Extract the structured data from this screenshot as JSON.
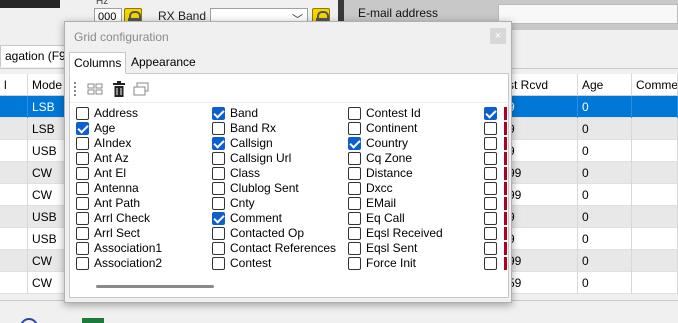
{
  "background": {
    "hz_label": "Hz",
    "freq_value": "000",
    "rx_band_label": "RX Band",
    "rx_band_value": "",
    "email_label": "E-mail address",
    "tab_label": "agation (F9",
    "grid": {
      "headers": [
        "l",
        "Mode",
        "",
        "st Rcvd",
        "Age",
        "Comme"
      ],
      "rows": [
        {
          "mode": "LSB",
          "rcvd": "9",
          "age": "0"
        },
        {
          "mode": "LSB",
          "rcvd": "9",
          "age": "0"
        },
        {
          "mode": "USB",
          "rcvd": "9",
          "age": "0"
        },
        {
          "mode": "CW",
          "rcvd": "99",
          "age": "0"
        },
        {
          "mode": "CW",
          "rcvd": "99",
          "age": "0"
        },
        {
          "mode": "USB",
          "rcvd": "9",
          "age": "0"
        },
        {
          "mode": "USB",
          "rcvd": "9",
          "age": "0"
        },
        {
          "mode": "CW",
          "rcvd": "99",
          "age": "0"
        },
        {
          "mode": "CW",
          "rcvd": "59",
          "age": "0"
        }
      ]
    }
  },
  "dialog": {
    "title": "Grid configuration",
    "close_glyph": "×",
    "tabs": [
      "Columns",
      "Appearance"
    ],
    "toolbar": {
      "grid_icon": "grid-layout-icon",
      "delete_icon": "trash-icon",
      "window_icon": "window-icon"
    },
    "columns": [
      [
        {
          "label": "Address",
          "checked": false
        },
        {
          "label": "Age",
          "checked": true
        },
        {
          "label": "AIndex",
          "checked": false
        },
        {
          "label": "Ant Az",
          "checked": false
        },
        {
          "label": "Ant El",
          "checked": false
        },
        {
          "label": "Antenna",
          "checked": false
        },
        {
          "label": "Ant Path",
          "checked": false
        },
        {
          "label": "Arrl Check",
          "checked": false
        },
        {
          "label": "Arrl Sect",
          "checked": false
        },
        {
          "label": "Association1",
          "checked": false
        },
        {
          "label": "Association2",
          "checked": false
        }
      ],
      [
        {
          "label": "Band",
          "checked": true
        },
        {
          "label": "Band Rx",
          "checked": false
        },
        {
          "label": "Callsign",
          "checked": true
        },
        {
          "label": "Callsign Url",
          "checked": false
        },
        {
          "label": "Class",
          "checked": false
        },
        {
          "label": "Clublog Sent",
          "checked": false
        },
        {
          "label": "Cnty",
          "checked": false
        },
        {
          "label": "Comment",
          "checked": true
        },
        {
          "label": "Contacted Op",
          "checked": false
        },
        {
          "label": "Contact References",
          "checked": false
        },
        {
          "label": "Contest",
          "checked": false
        }
      ],
      [
        {
          "label": "Contest Id",
          "checked": false
        },
        {
          "label": "Continent",
          "checked": false
        },
        {
          "label": "Country",
          "checked": true
        },
        {
          "label": "Cq Zone",
          "checked": false
        },
        {
          "label": "Distance",
          "checked": false
        },
        {
          "label": "Dxcc",
          "checked": false
        },
        {
          "label": "EMail",
          "checked": false
        },
        {
          "label": "Eq Call",
          "checked": false
        },
        {
          "label": "Eqsl Received",
          "checked": false
        },
        {
          "label": "Eqsl Sent",
          "checked": false
        },
        {
          "label": "Force Init",
          "checked": false
        }
      ],
      [
        {
          "checked": true
        },
        {
          "checked": false
        },
        {
          "checked": false
        },
        {
          "checked": false
        },
        {
          "checked": false
        },
        {
          "checked": false
        },
        {
          "checked": false
        },
        {
          "checked": false
        },
        {
          "checked": false
        },
        {
          "checked": false
        },
        {
          "checked": false
        }
      ]
    ]
  },
  "colors": {
    "selection": "#0078d7",
    "checkbox_checked": "#0b5fd1",
    "lock": "#f5d400"
  }
}
